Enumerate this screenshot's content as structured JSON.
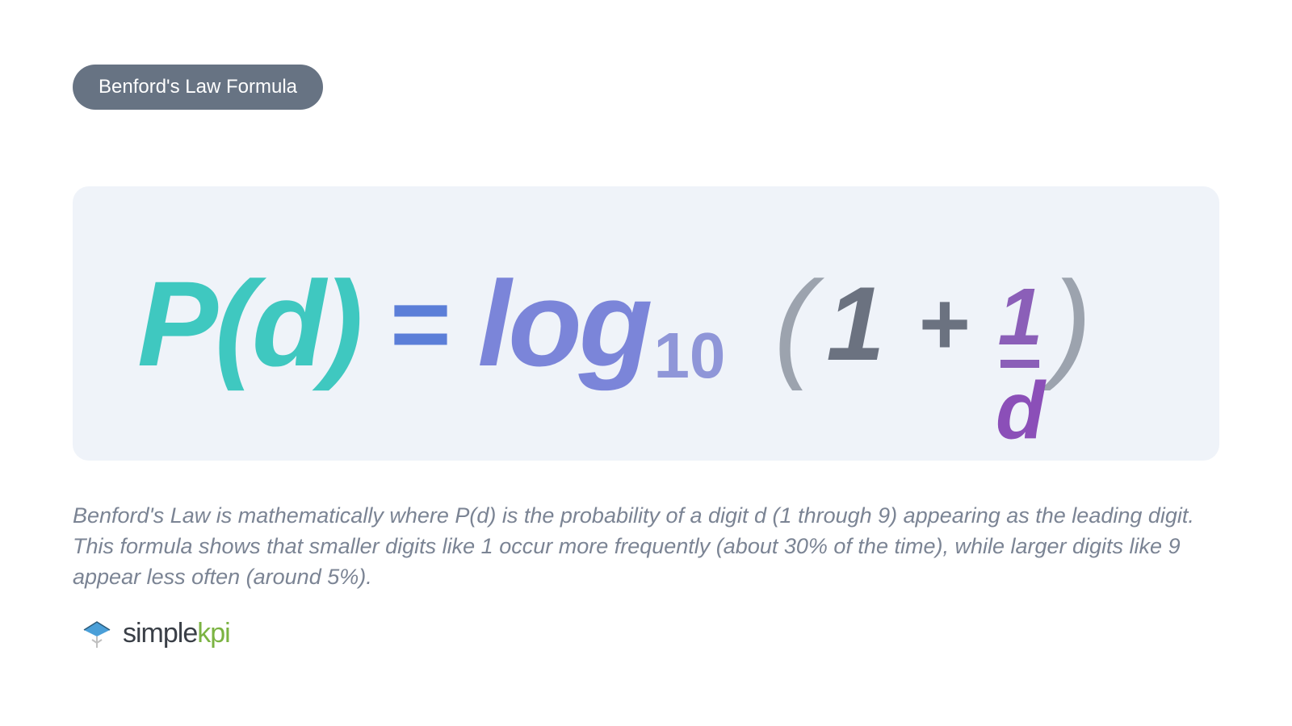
{
  "title": "Benford's Law Formula",
  "formula": {
    "pd": "P(d)",
    "equals": "=",
    "log": "log",
    "logSubscript": "10",
    "openParen": "(",
    "one": "1",
    "plus": "+",
    "fracNum": "1",
    "fracDen": "d",
    "closeParen": ")"
  },
  "description": "Benford's Law is mathematically where  P(d) is the probability of a digit d (1 through 9) appearing as the leading digit. This formula shows that smaller digits like 1 occur more frequently (about 30% of the time), while larger digits like 9 appear less often (around 5%).",
  "brand": {
    "simple": "simple",
    "kpi": "kpi"
  }
}
